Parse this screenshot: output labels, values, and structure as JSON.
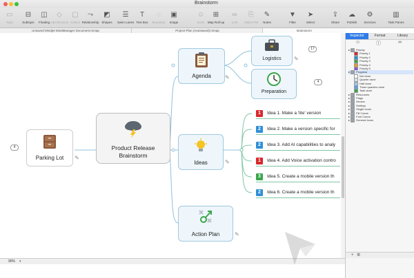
{
  "window": {
    "title": "Brainstorm"
  },
  "toolbar": {
    "buttons": [
      {
        "label": "Topic",
        "icon": "topic-icon",
        "enabled": false
      },
      {
        "label": "Subtopic",
        "icon": "subtopic-icon",
        "enabled": true
      },
      {
        "label": "Floating",
        "icon": "floating-icon",
        "enabled": true
      },
      {
        "label": "Add Decision",
        "icon": "decision-icon",
        "enabled": false
      },
      {
        "label": "Callout",
        "icon": "callout-icon",
        "enabled": false
      },
      {
        "label": "Relationship",
        "icon": "relationship-icon",
        "enabled": true
      },
      {
        "label": "Shapes",
        "icon": "shapes-icon",
        "enabled": true
      },
      {
        "label": "Swim Lanes",
        "icon": "swimlanes-icon",
        "enabled": true
      },
      {
        "label": "Text Box",
        "icon": "textbox-icon",
        "enabled": true
      },
      {
        "label": "Boundary",
        "icon": "boundary-icon",
        "enabled": false
      },
      {
        "label": "Image",
        "icon": "image-icon",
        "enabled": true
      },
      {
        "label": "Icons",
        "icon": "icons-icon",
        "enabled": false
      },
      {
        "label": "Map Roll-up",
        "icon": "rollup-icon",
        "enabled": true
      },
      {
        "label": "Link",
        "icon": "link-icon",
        "enabled": false
      },
      {
        "label": "Attach File",
        "icon": "attach-icon",
        "enabled": false
      },
      {
        "label": "Notes",
        "icon": "notes-icon",
        "enabled": true
      },
      {
        "label": "Filter",
        "icon": "filter-icon",
        "enabled": true
      },
      {
        "label": "Select",
        "icon": "select-icon",
        "enabled": true
      },
      {
        "label": "Share",
        "icon": "share-icon",
        "enabled": true
      },
      {
        "label": "Publish",
        "icon": "publish-icon",
        "enabled": true
      },
      {
        "label": "Services",
        "icon": "services-icon",
        "enabled": true
      },
      {
        "label": "Task Panes",
        "icon": "taskpanes-icon",
        "enabled": true
      }
    ]
  },
  "doc_tabs": [
    {
      "label": "Unsaved Mindjet MindManager Document.mmap"
    },
    {
      "label": "Project Plan (Autosaved).mmap"
    },
    {
      "label": "Brainstorm"
    }
  ],
  "map": {
    "central": {
      "label_line1": "Product Release",
      "label_line2": "Brainstorm",
      "icon": "storm-cloud-icon"
    },
    "parking": {
      "label": "Parking Lot",
      "count": "4",
      "icon": "cabinet-icon"
    },
    "agenda": {
      "label": "Agenda",
      "icon": "clipboard-icon"
    },
    "logistics": {
      "label": "Logistics",
      "count": "17",
      "icon": "briefcase-icon"
    },
    "preparation": {
      "label": "Preparation",
      "count": "4",
      "icon": "clock-icon"
    },
    "ideas": {
      "label": "Ideas",
      "icon": "lightbulb-icon"
    },
    "action": {
      "label": "Action Plan",
      "icon": "action-icon"
    },
    "idea_items": [
      {
        "priority": "1",
        "text": "Idea 1. Make a 'lite' version",
        "color": "#d9282b"
      },
      {
        "priority": "2",
        "text": "Idea 2. Make a version specific for",
        "color": "#2f8fd6"
      },
      {
        "priority": "2",
        "text": "Idea 3. Add AI capabilities to analy",
        "color": "#2f8fd6"
      },
      {
        "priority": "1",
        "text": "Idea 4. Add Voice activation contro",
        "color": "#d9282b"
      },
      {
        "priority": "3",
        "text": "Idea 5. Create a mobile version th",
        "color": "#3aa64a"
      },
      {
        "priority": "2",
        "text": "Idea 6. Create a mobile version th",
        "color": "#2f8fd6"
      }
    ]
  },
  "status": {
    "zoom": "90%"
  },
  "panel": {
    "tabs": [
      {
        "label": "Inspector"
      },
      {
        "label": "Format"
      },
      {
        "label": "Library"
      }
    ],
    "rows": [
      {
        "label": "Priority",
        "indent": 1,
        "swatch": "",
        "hl": false
      },
      {
        "label": "Priority 1",
        "indent": 2,
        "swatch": "#d9282b",
        "hl": false
      },
      {
        "label": "Priority 2",
        "indent": 2,
        "swatch": "#2f8fd6",
        "hl": false
      },
      {
        "label": "Priority 3",
        "indent": 2,
        "swatch": "#3aa64a",
        "hl": false
      },
      {
        "label": "Priority 4",
        "indent": 2,
        "swatch": "#e89a2a",
        "hl": false
      },
      {
        "label": "Priority 5",
        "indent": 2,
        "swatch": "#8a5cc9",
        "hl": false
      },
      {
        "label": "Progress",
        "indent": 1,
        "swatch": "",
        "hl": true
      },
      {
        "label": "Not done",
        "indent": 2,
        "swatch": "#ffffff",
        "hl": false
      },
      {
        "label": "Quarter done",
        "indent": 2,
        "swatch": "#cfe3f7",
        "hl": false
      },
      {
        "label": "Half done",
        "indent": 2,
        "swatch": "#9fc6ee",
        "hl": false
      },
      {
        "label": "Three quarters done",
        "indent": 2,
        "swatch": "#5d9fe3",
        "hl": false
      },
      {
        "label": "Task done",
        "indent": 2,
        "swatch": "#3aa64a",
        "hl": false
      },
      {
        "label": "Resources",
        "indent": 1,
        "swatch": "",
        "hl": false
      },
      {
        "label": "Flags",
        "indent": 1,
        "swatch": "",
        "hl": false
      },
      {
        "label": "Arrows",
        "indent": 1,
        "swatch": "",
        "hl": false
      },
      {
        "label": "Smileys",
        "indent": 1,
        "swatch": "",
        "hl": false
      },
      {
        "label": "Single Icons",
        "indent": 1,
        "swatch": "",
        "hl": false
      },
      {
        "label": "Fill Colors",
        "indent": 1,
        "swatch": "",
        "hl": false
      },
      {
        "label": "Font Colors",
        "indent": 1,
        "swatch": "",
        "hl": false
      },
      {
        "label": "General Icons",
        "indent": 1,
        "swatch": "",
        "hl": false
      }
    ]
  }
}
